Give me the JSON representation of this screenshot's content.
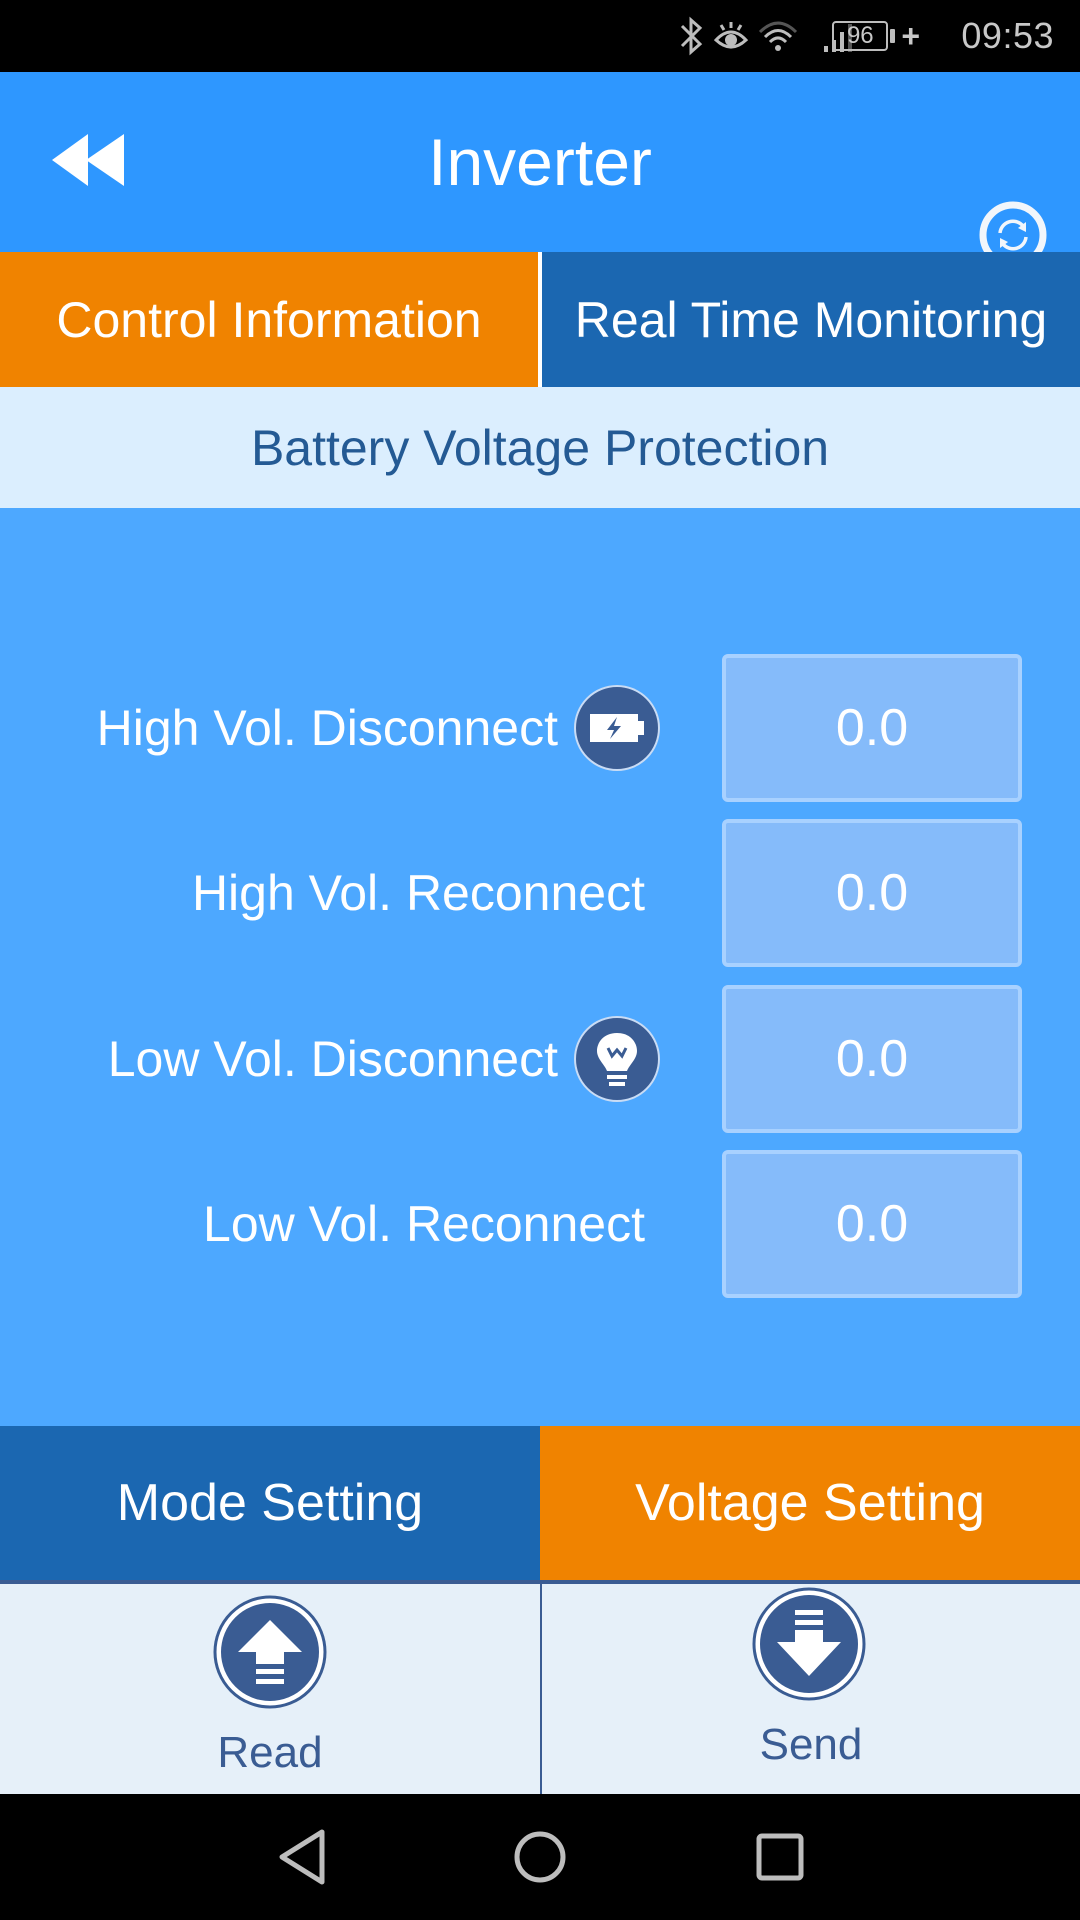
{
  "status_bar": {
    "icons": [
      "bluetooth-icon",
      "eye-comfort-icon",
      "wifi-icon",
      "signal-icon"
    ],
    "battery_level": "96",
    "charging_indicator": "+",
    "time": "09:53"
  },
  "header": {
    "title": "Inverter",
    "back_icon": "double-chevron-left-icon",
    "refresh_icon": "refresh-icon"
  },
  "tabs": [
    {
      "label": "Control Information",
      "active": true
    },
    {
      "label": "Real Time Monitoring",
      "active": false
    }
  ],
  "section": {
    "title": "Battery Voltage Protection"
  },
  "settings": [
    {
      "label": "High Vol. Disconnect",
      "value": "0.0",
      "icon": "battery-charging-icon"
    },
    {
      "label": "High Vol. Reconnect",
      "value": "0.0",
      "icon": null
    },
    {
      "label": "Low Vol. Disconnect",
      "value": "0.0",
      "icon": "lightbulb-icon"
    },
    {
      "label": "Low Vol. Reconnect",
      "value": "0.0",
      "icon": null
    }
  ],
  "bottom_tabs": [
    {
      "label": "Mode Setting",
      "active": false
    },
    {
      "label": "Voltage Setting",
      "active": true
    }
  ],
  "actions": [
    {
      "label": "Read",
      "icon": "upload-arrow-icon"
    },
    {
      "label": "Send",
      "icon": "download-arrow-icon"
    }
  ],
  "navbar": {
    "icons": [
      "back-triangle-icon",
      "home-circle-icon",
      "recents-square-icon"
    ]
  },
  "colors": {
    "header_blue": "#2e97ff",
    "active_orange": "#f08300",
    "inactive_blue": "#1b67b1",
    "content_blue": "#4da8ff",
    "section_bg": "#dbeefe",
    "icon_navy": "#3a5c93"
  }
}
